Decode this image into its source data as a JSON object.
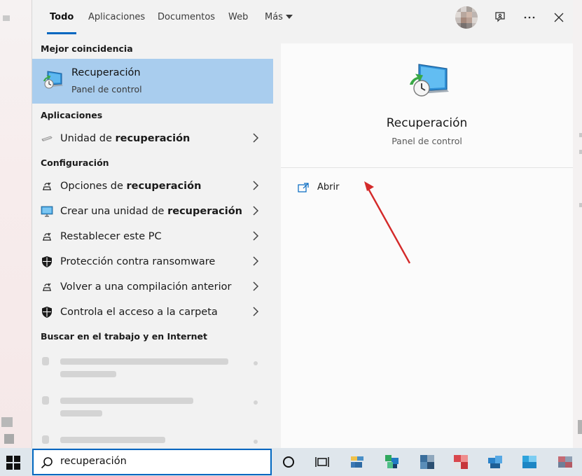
{
  "tabs": [
    {
      "label": "Todo",
      "active": true
    },
    {
      "label": "Aplicaciones"
    },
    {
      "label": "Documentos"
    },
    {
      "label": "Web"
    },
    {
      "label": "Más"
    }
  ],
  "topbar_icons": [
    "avatar",
    "feedback-icon",
    "more-options-icon",
    "close-icon"
  ],
  "best_match": {
    "section": "Mejor coincidencia",
    "title": "Recuperación",
    "subtitle": "Panel de control"
  },
  "apps": {
    "section": "Aplicaciones",
    "items": [
      {
        "prefix": "Unidad de ",
        "bold": "recuperación",
        "icon": "drive-icon"
      }
    ]
  },
  "settings": {
    "section": "Configuración",
    "items": [
      {
        "prefix": "Opciones de ",
        "bold": "recuperación",
        "suffix": "",
        "icon": "recovery-settings-icon"
      },
      {
        "prefix": "Crear una unidad de ",
        "bold": "recuperación",
        "suffix": "",
        "icon": "monitor-icon"
      },
      {
        "prefix": "Restablecer este PC",
        "bold": "",
        "suffix": "",
        "icon": "reset-pc-icon"
      },
      {
        "prefix": "Protección contra ransomware",
        "bold": "",
        "suffix": "",
        "icon": "shield-icon"
      },
      {
        "prefix": "Volver a una compilación anterior",
        "bold": "",
        "suffix": "",
        "icon": "rollback-icon"
      },
      {
        "prefix": "Controla el acceso a la carpeta",
        "bold": "",
        "suffix": "",
        "icon": "shield-icon"
      }
    ]
  },
  "web": {
    "section": "Buscar en el trabajo y en Internet"
  },
  "detail": {
    "title": "Recuperación",
    "subtitle": "Panel de control",
    "action_label": "Abrir"
  },
  "search": {
    "value": "recuperación"
  },
  "colors": {
    "accent": "#0067c0",
    "selection": "#a9cdee",
    "arrow": "#d42a2a"
  }
}
